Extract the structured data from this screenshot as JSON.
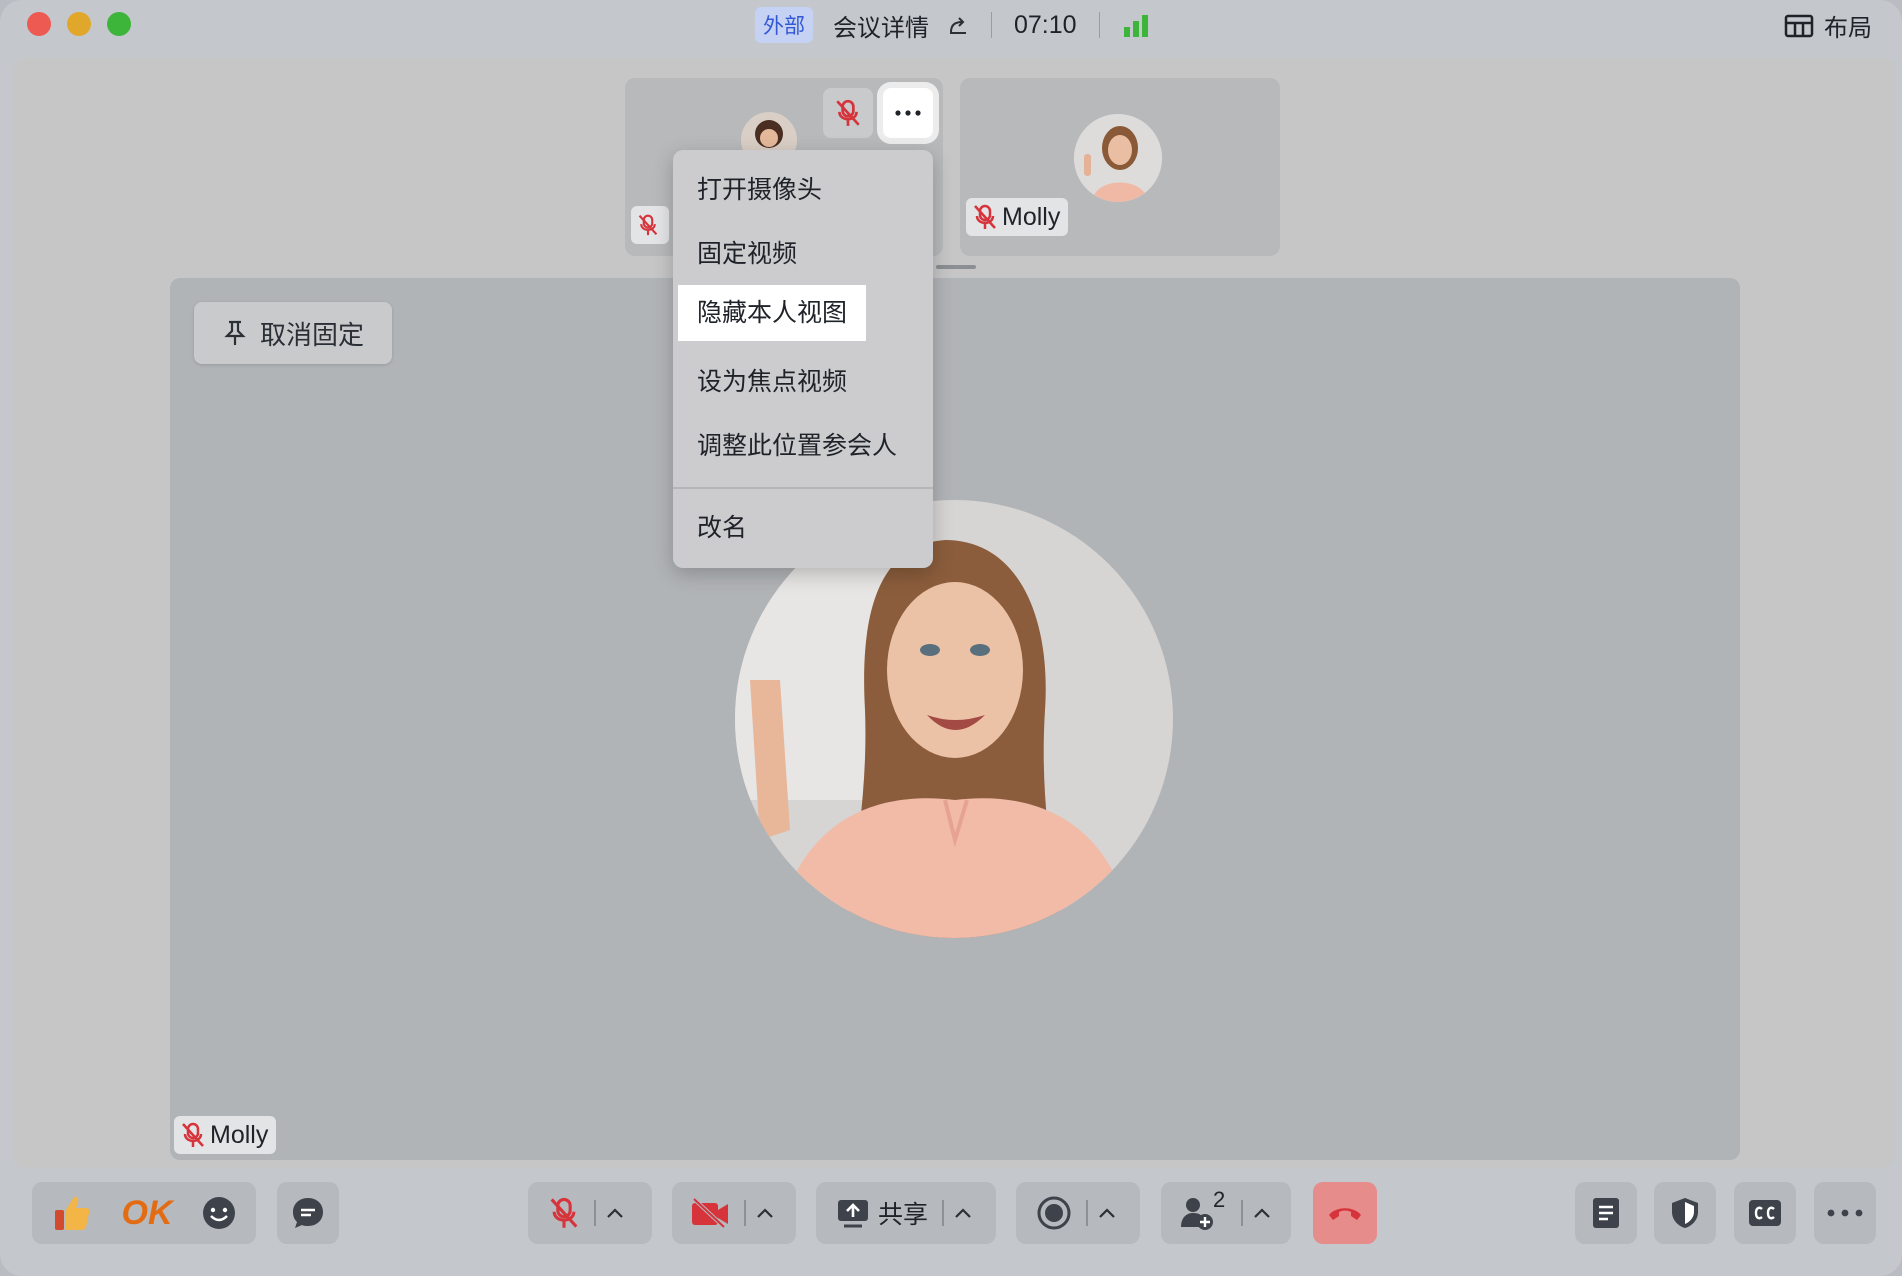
{
  "titlebar": {
    "badge": "外部",
    "title": "会议详情",
    "time": "07:10",
    "layout_label": "布局"
  },
  "thumbnails": [
    {
      "name": ""
    },
    {
      "name": "Molly"
    }
  ],
  "main": {
    "unpin_label": "取消固定",
    "speaker_name": "Molly"
  },
  "context_menu": {
    "items": [
      "打开摄像头",
      "固定视频",
      "隐藏本人视图",
      "设为焦点视频",
      "调整此位置参会人",
      "改名"
    ],
    "highlighted_index": 2
  },
  "toolbar": {
    "reaction_ok": "OK",
    "share_label": "共享",
    "participants_count": "2"
  },
  "colors": {
    "muted_red": "#d6333b",
    "signal_green": "#3cb53a",
    "hangup": "#e68c8a",
    "badge_blue": "#3358d4"
  }
}
